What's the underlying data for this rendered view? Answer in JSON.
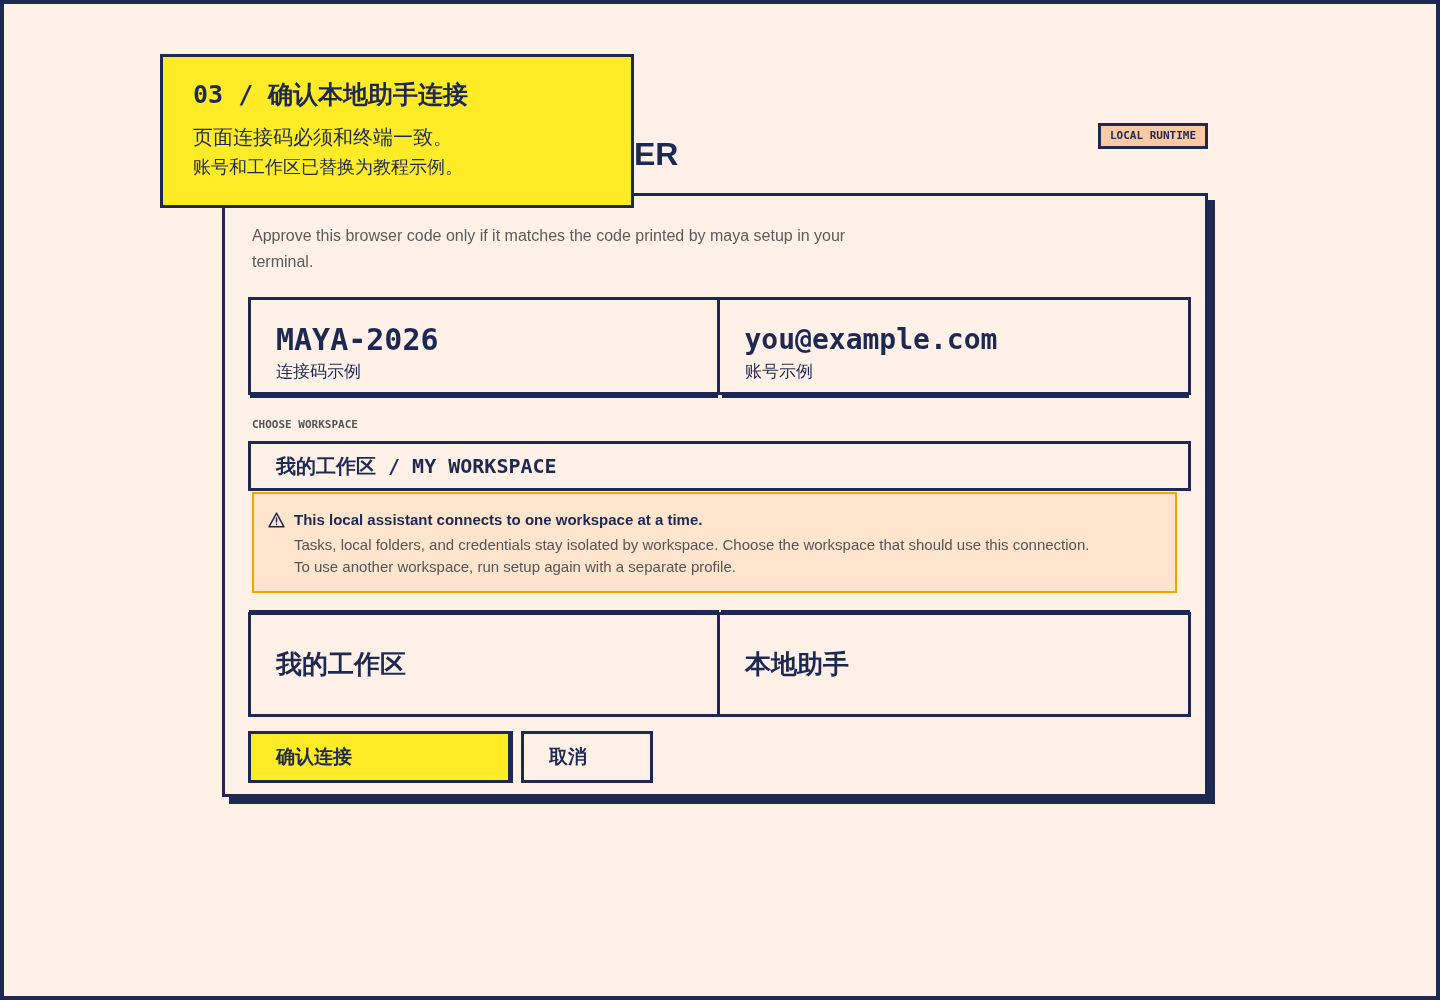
{
  "callout": {
    "title": "03 / 确认本地助手连接",
    "lines": [
      "页面连接码必须和终端一致。",
      "账号和工作区已替换为教程示例。"
    ]
  },
  "header": {
    "title": "ER",
    "badge": "LOCAL RUNTIME"
  },
  "card": {
    "description": "Approve this browser code only if it matches the code printed by maya setup in your terminal.",
    "identity_tiles": [
      {
        "value": "MAYA-2026",
        "caption": "连接码示例"
      },
      {
        "value": "you@example.com",
        "caption": "账号示例"
      }
    ],
    "workspace_select": {
      "label": "CHOOSE WORKSPACE",
      "value": "我的工作区 / MY WORKSPACE"
    },
    "warning": {
      "title": "This local assistant connects to one workspace at a time.",
      "body": [
        "Tasks, local folders, and credentials stay isolated by workspace. Choose the workspace that should use this connection.",
        "To use another workspace, run setup again with a separate profile."
      ]
    },
    "summary_tiles": [
      "我的工作区",
      "本地助手"
    ],
    "buttons": [
      {
        "label": "确认连接",
        "kind": "primary"
      },
      {
        "label": "取消",
        "kind": "secondary"
      }
    ]
  }
}
